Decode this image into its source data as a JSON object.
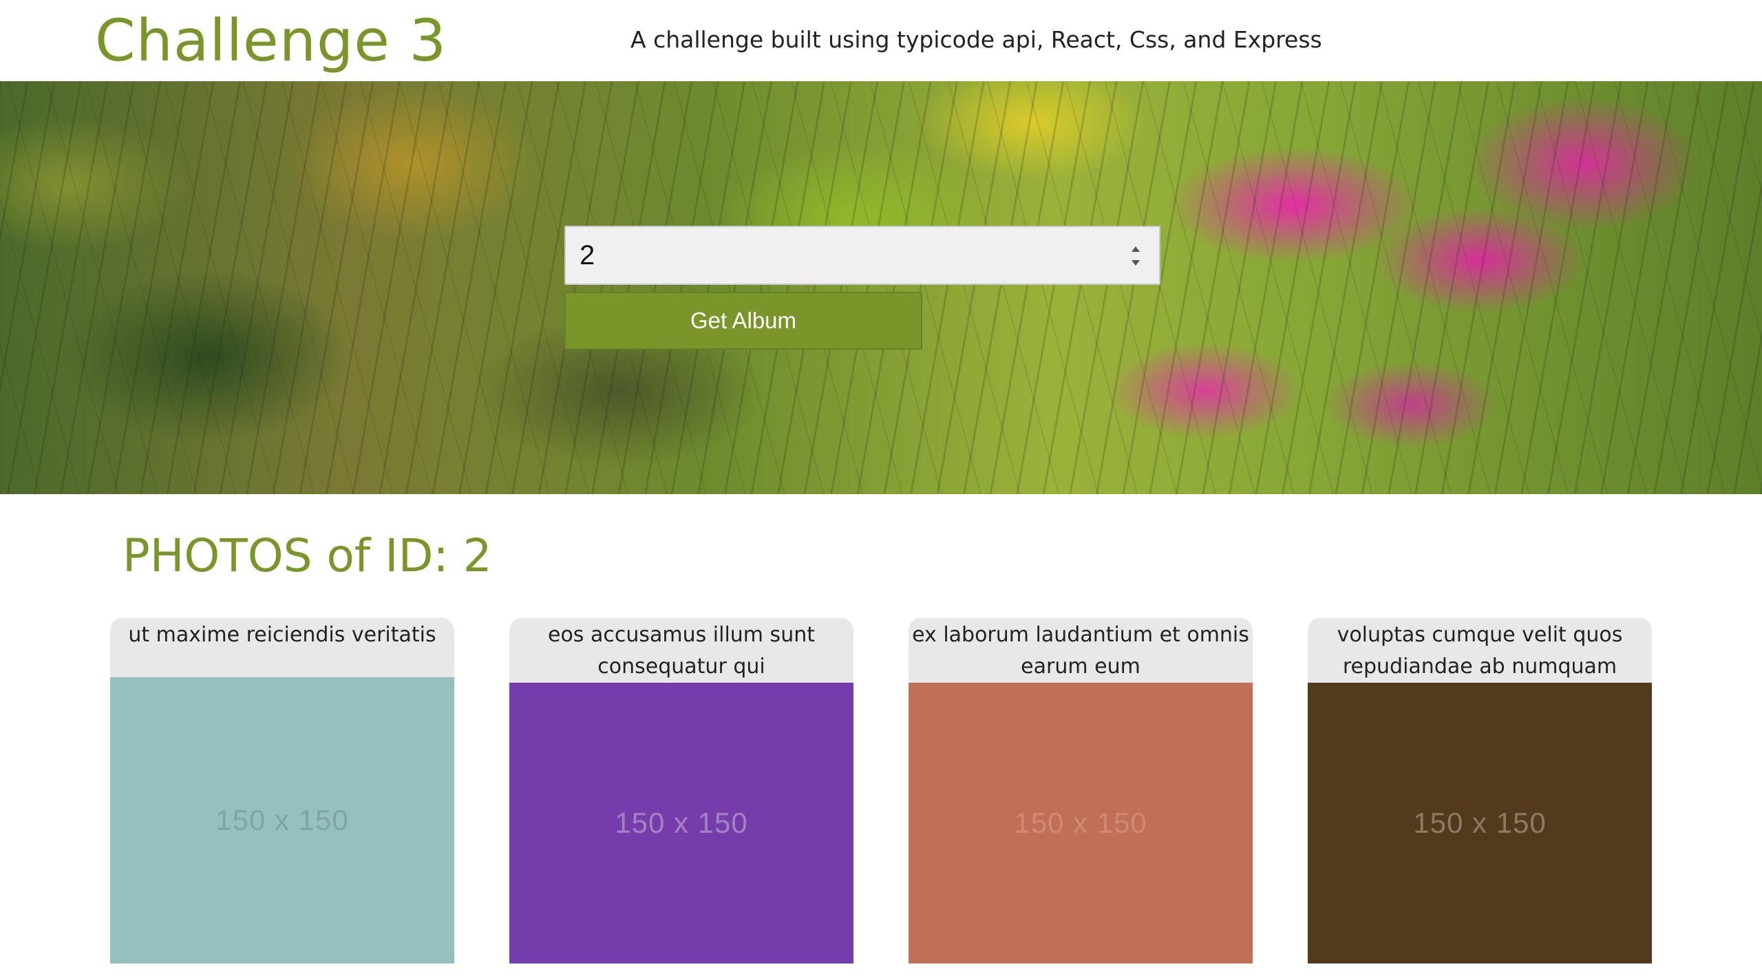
{
  "header": {
    "title": "Challenge 3",
    "subtitle": "A challenge built using typicode api, React, Css, and Express"
  },
  "form": {
    "album_id_value": "2",
    "submit_label": "Get Album"
  },
  "photos": {
    "heading": "PHOTOS of ID: 2",
    "cards": [
      {
        "title": "ut maxime reiciendis veritatis",
        "image_label": "150 x 150",
        "image_color": "#94c0bf",
        "label_color": "#7fa4a3"
      },
      {
        "title": "eos accusamus illum sunt consequatur qui",
        "image_label": "150 x 150",
        "image_color": "#773cac",
        "label_color": "#a184c0"
      },
      {
        "title": "ex laborum laudantium et omnis earum eum",
        "image_label": "150 x 150",
        "image_color": "#c16f57",
        "label_color": "#cf8a75"
      },
      {
        "title": "voluptas cumque velit quos repudiandae ab numquam",
        "image_label": "150 x 150",
        "image_color": "#533a1c",
        "label_color": "#8a7a66"
      }
    ]
  },
  "colors": {
    "accent": "#7a962a",
    "card_header_bg": "#e8e8e8",
    "input_bg": "#f0f0f0"
  }
}
